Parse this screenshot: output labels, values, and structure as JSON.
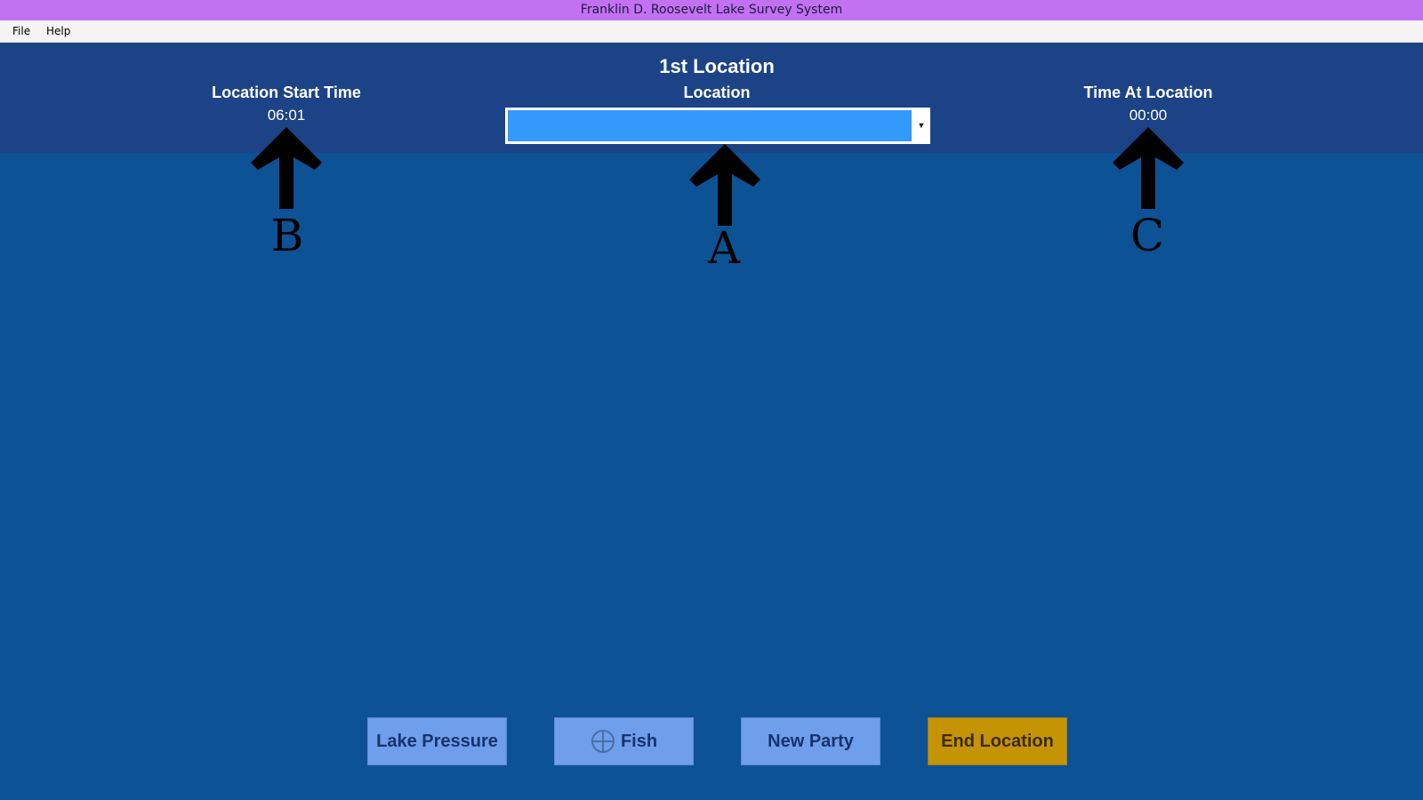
{
  "window": {
    "title": "Franklin D. Roosevelt Lake Survey System"
  },
  "menu": {
    "items": [
      "File",
      "Help"
    ]
  },
  "header": {
    "title": "1st Location",
    "start_time": {
      "label": "Location Start Time",
      "value": "06:01"
    },
    "location": {
      "label": "Location",
      "selected": ""
    },
    "time_at": {
      "label": "Time At Location",
      "value": "00:00"
    }
  },
  "annotations": {
    "a": "A",
    "b": "B",
    "c": "C"
  },
  "buttons": {
    "lake_pressure": "Lake Pressure",
    "fish": "Fish",
    "new_party": "New Party",
    "end_location": "End Location"
  },
  "colors": {
    "titlebar": "#c271f3",
    "header": "#1c4386",
    "background": "#0e5296",
    "button": "#6f9eea",
    "end_button": "#c49406",
    "dropdown_field": "#3399fb"
  },
  "icons": {
    "fish_button": "plus-circle-icon",
    "dropdown": "dropdown-arrow-icon",
    "annotation": "up-arrow-icon"
  }
}
